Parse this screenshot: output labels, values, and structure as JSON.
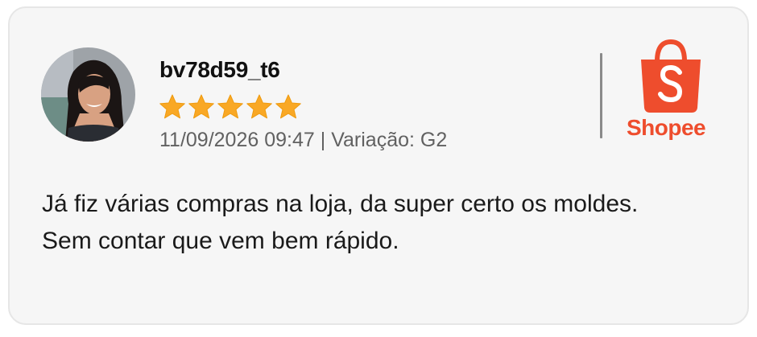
{
  "review": {
    "username": "bv78d59_t6",
    "rating": 5,
    "rating_max": 5,
    "star_color": "#f9a825",
    "date": "11/09/2026 09:47",
    "separator": "|",
    "variation_label": "Variação:",
    "variation_value": "G2",
    "text_lines": [
      "Já fiz várias compras na loja, da super certo os moldes.",
      "Sem contar que vem bem rápido."
    ]
  },
  "brand": {
    "name": "Shopee",
    "logo_icon": "shopee-bag-icon",
    "color": "#ee4d2d"
  },
  "avatar": {
    "icon": "user-photo-avatar"
  }
}
